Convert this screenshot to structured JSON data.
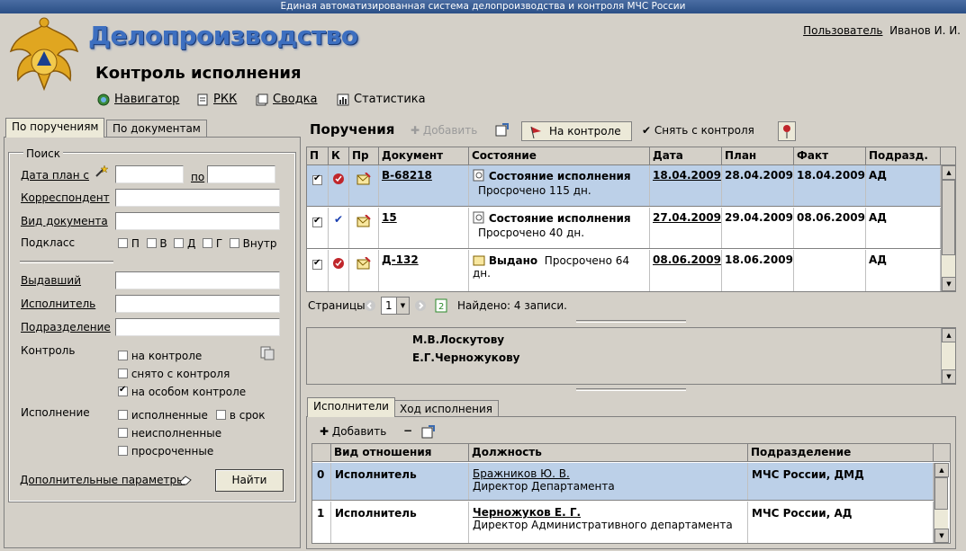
{
  "system_title": "Единая автоматизированная система делопроизводства и контроля МЧС России",
  "app_title": "Делопроизводство",
  "page_title": "Контроль исполнения",
  "user": {
    "label": "Пользователь",
    "name": "Иванов И. И."
  },
  "nav": [
    {
      "label": "Навигатор",
      "icon": "navigator-icon"
    },
    {
      "label": "РКК",
      "icon": "rkk-icon"
    },
    {
      "label": "Сводка",
      "icon": "summary-icon"
    },
    {
      "label": "Статистика",
      "icon": "statistics-icon"
    }
  ],
  "left_tabs": [
    "По поручениям",
    "По документам"
  ],
  "search": {
    "legend": "Поиск",
    "date_plan_from": "Дата план с",
    "date_to": "по",
    "correspondent": "Корреспондент",
    "doc_type": "Вид документа",
    "subclass": "Подкласс",
    "subclass_options": [
      "П",
      "В",
      "Д",
      "Г",
      "Внутр"
    ],
    "issuer": "Выдавший",
    "executor": "Исполнитель",
    "department": "Подразделение",
    "control": "Контроль",
    "control_options": [
      {
        "label": "на контроле",
        "checked": false
      },
      {
        "label": "снято с контроля",
        "checked": false
      },
      {
        "label": "на особом контроле",
        "checked": true
      }
    ],
    "execution": "Исполнение",
    "exec_options": [
      {
        "label": "исполненные",
        "checked": false
      },
      {
        "label": "в срок",
        "checked": false
      },
      {
        "label": "неисполненные",
        "checked": false
      },
      {
        "label": "просроченные",
        "checked": false
      }
    ],
    "extra_params": "Дополнительные параметры",
    "find_button": "Найти"
  },
  "orders": {
    "title": "Поручения",
    "add": "Добавить",
    "on_control": "На контроле",
    "remove_control": "Снять с контроля",
    "columns": [
      "П",
      "К",
      "Пр",
      "Документ",
      "Состояние",
      "Дата",
      "План",
      "Факт",
      "Подразд."
    ],
    "rows": [
      {
        "checked": true,
        "k": "red-stamp",
        "doc": "В-68218",
        "state": "Состояние исполнения",
        "note": "Просрочено 115 дн.",
        "date": "18.04.2009",
        "plan": "28.04.2009",
        "fact": "18.04.2009",
        "dept": "АД",
        "selected": true
      },
      {
        "checked": true,
        "k": "check",
        "doc": "15",
        "state": "Состояние исполнения",
        "note": "Просрочено 40 дн.",
        "date": "27.04.2009",
        "plan": "29.04.2009",
        "fact": "08.06.2009",
        "dept": "АД",
        "selected": false
      },
      {
        "checked": true,
        "k": "red-stamp",
        "doc": "Д-132",
        "state": "Выдано",
        "note": "Просрочено 64 дн.",
        "date": "08.06.2009",
        "plan": "18.06.2009",
        "fact": "",
        "dept": "АД",
        "selected": false
      }
    ],
    "pages_label": "Страницы",
    "page": "1",
    "found": "Найдено: 4 записи."
  },
  "recipients": [
    "М.В.Лоскутову",
    "Е.Г.Черножукову"
  ],
  "bottom_tabs": [
    "Исполнители",
    "Ход исполнения"
  ],
  "executors": {
    "add": "Добавить",
    "columns": [
      "",
      "Вид отношения",
      "Должность",
      "Подразделение"
    ],
    "rows": [
      {
        "n": "0",
        "relation": "Исполнитель",
        "name": "Бражников Ю. В.",
        "position": "Директор Департамента",
        "dept": "МЧС России, ДМД",
        "selected": true,
        "bold_name": false
      },
      {
        "n": "1",
        "relation": "Исполнитель",
        "name": "Черножуков Е. Г.",
        "position": "Директор Административного департамента",
        "dept": "МЧС России, АД",
        "selected": false,
        "bold_name": true
      }
    ]
  },
  "colors": {
    "accent": "#3d6fc0",
    "selected_row": "#bcd0e8",
    "red": "#c0262b"
  }
}
